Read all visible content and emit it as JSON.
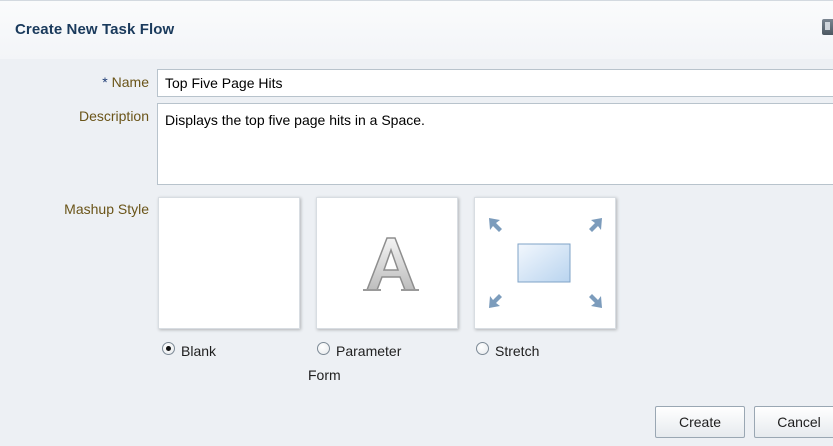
{
  "dialog": {
    "title": "Create New Task Flow"
  },
  "form": {
    "name_required_marker": "*",
    "name_label": "Name",
    "name_value": "Top Five Page Hits",
    "description_label": "Description",
    "description_value": "Displays the top five page hits in a Space.",
    "mashup_label": "Mashup Style"
  },
  "mashup_styles": [
    {
      "label": "Blank",
      "selected": true
    },
    {
      "label": "Parameter Form",
      "label_line1": "Parameter",
      "label_line2": "Form",
      "selected": false
    },
    {
      "label": "Stretch",
      "selected": false
    }
  ],
  "buttons": {
    "create": "Create",
    "cancel": "Cancel"
  },
  "icons": {
    "close": "close-icon",
    "parameter_form": "letter-a-icon",
    "stretch": "expand-arrows-icon"
  },
  "colors": {
    "title": "#1a3a5c",
    "label": "#6a5418",
    "required": "#1f3d75",
    "dialog_bg": "#edf0f4"
  }
}
